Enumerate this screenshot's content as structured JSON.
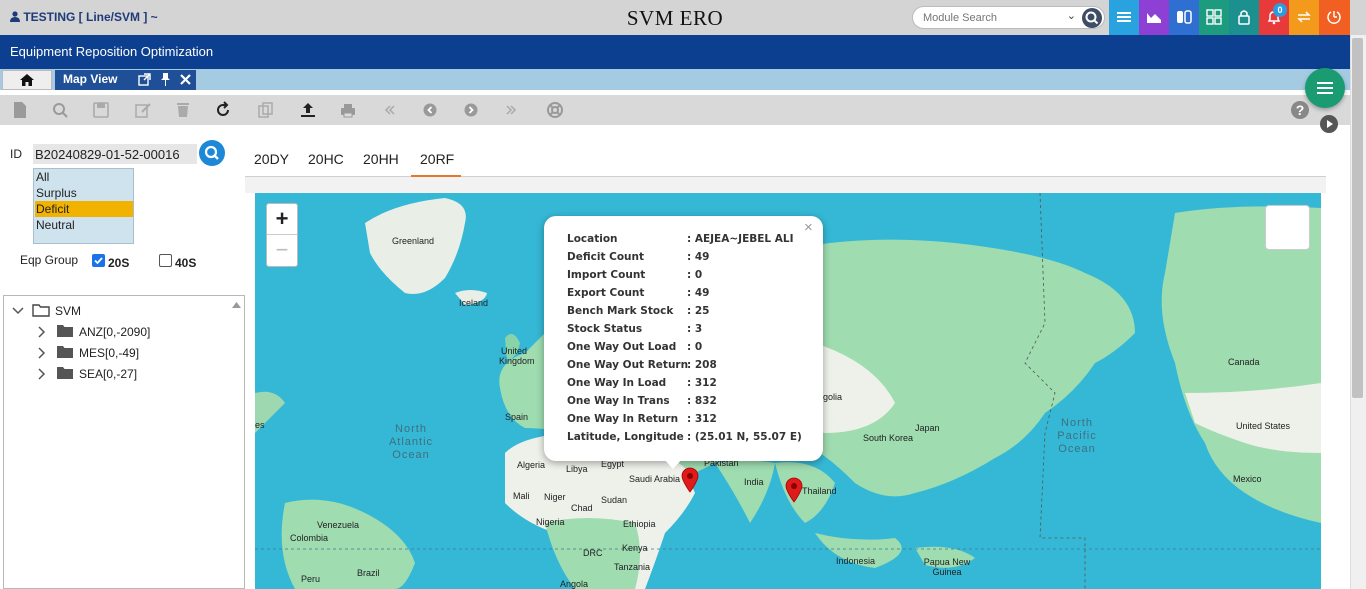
{
  "header": {
    "user": "TESTING [ Line/SVM ] ~",
    "title": "SVM ERO",
    "search_placeholder": "Module Search",
    "notification_count": "0",
    "icon_colors": [
      "#29a3e0",
      "#8e3fd4",
      "#2f6fd1",
      "#1c9b7e",
      "#1c8f8f",
      "#e83a3a",
      "#f39a1c",
      "#f25f22"
    ]
  },
  "module_title": "Equipment Reposition Optimization",
  "tabs": {
    "home_icon": "home-icon",
    "active_tab": "Map View"
  },
  "toolbar": {
    "icons": [
      "new-icon",
      "search-icon",
      "save-icon",
      "edit-icon",
      "delete-icon",
      "refresh-icon",
      "copy-icon",
      "upload-icon",
      "print-icon",
      "first-icon",
      "prev-icon",
      "next-icon",
      "last-icon",
      "lifebuoy-icon"
    ]
  },
  "filter": {
    "id_label": "ID",
    "id_value": "B20240829-01-52-00016",
    "status_options": [
      "All",
      "Surplus",
      "Deficit",
      "Neutral"
    ],
    "selected_status": "Deficit",
    "eqp_group_label": "Eqp Group",
    "eqp_options": [
      {
        "label": "20S",
        "checked": true
      },
      {
        "label": "40S",
        "checked": false
      }
    ]
  },
  "tree": {
    "root": "SVM",
    "children": [
      "ANZ[0,-2090]",
      "MES[0,-49]",
      "SEA[0,-27]"
    ]
  },
  "map_tabs": [
    "20DY",
    "20HC",
    "20HH",
    "20RF"
  ],
  "active_map_tab": "20RF",
  "map": {
    "zoom_in": "+",
    "zoom_out": "−",
    "labels": {
      "greenland": "Greenland",
      "iceland": "Iceland",
      "uk": "United Kingdom",
      "spain": "Spain",
      "algeria": "Algeria",
      "libya": "Libya",
      "egypt": "Egypt",
      "saudi": "Saudi Arabia",
      "mali": "Mali",
      "niger": "Niger",
      "chad": "Chad",
      "sudan": "Sudan",
      "nigeria": "Nigeria",
      "ethiopia": "Ethiopia",
      "drc": "DRC",
      "kenya": "Kenya",
      "tanzania": "Tanzania",
      "angola": "Angola",
      "venezuela": "Venezuela",
      "colombia": "Colombia",
      "brazil": "Brazil",
      "peru": "Peru",
      "pakistan": "Pakistan",
      "india": "India",
      "thailand": "Thailand",
      "mongolia": "golia",
      "south_korea": "South Korea",
      "japan": "Japan",
      "indonesia": "Indonesia",
      "png": "Papua New Guinea",
      "canada": "Canada",
      "us": "United States",
      "mexico": "Mexico",
      "atlantic": "North Atlantic Ocean",
      "pacific": "North Pacific Ocean",
      "es": "es"
    }
  },
  "popup": {
    "rows": [
      {
        "k": "Location",
        "v": ": AEJEA~JEBEL ALI"
      },
      {
        "k": "Deficit Count",
        "v": ": 49"
      },
      {
        "k": "Import Count",
        "v": ": 0"
      },
      {
        "k": "Export Count",
        "v": ": 49"
      },
      {
        "k": "Bench Mark Stock",
        "v": ": 25"
      },
      {
        "k": "Stock Status",
        "v": ": 3"
      },
      {
        "k": "One Way Out Load",
        "v": ": 0"
      },
      {
        "k": "One Way Out Return",
        "v": ": 208"
      },
      {
        "k": "One Way In Load",
        "v": ": 312"
      },
      {
        "k": "One Way In Trans",
        "v": ": 832"
      },
      {
        "k": "One Way In Return",
        "v": ": 312"
      },
      {
        "k": "Latitude, Longitude",
        "v": ": (25.01 N, 55.07 E)"
      }
    ]
  }
}
